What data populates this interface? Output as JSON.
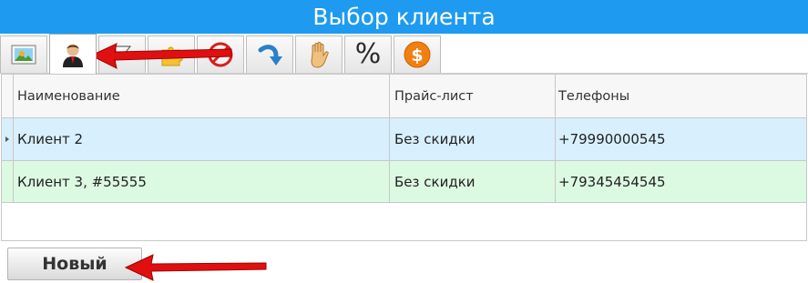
{
  "window": {
    "title": "Выбор клиента"
  },
  "toolbar": {
    "tabs": [
      {
        "icon": "image-icon"
      },
      {
        "icon": "user-icon",
        "active": true
      },
      {
        "icon": "flag-icon"
      },
      {
        "icon": "puzzle-icon"
      },
      {
        "icon": "no-entry-icon"
      },
      {
        "icon": "redo-arrow-icon"
      },
      {
        "icon": "hand-icon"
      },
      {
        "icon": "percent-icon",
        "glyph": "%"
      },
      {
        "icon": "dollar-coin-icon",
        "glyph": "$"
      }
    ]
  },
  "grid": {
    "columns": [
      "Наименование",
      "Прайс-лист",
      "Телефоны"
    ],
    "rows": [
      {
        "name": "Клиент 2",
        "price_list": "Без скидки",
        "phone": "+79990000545",
        "color": "#d8effd",
        "current": true
      },
      {
        "name": "Клиент 3, #55555",
        "price_list": "Без скидки",
        "phone": "+79345454545",
        "color": "#dcf9e2"
      }
    ]
  },
  "actions": {
    "new_label": "Новый"
  },
  "colors": {
    "titlebar": "#1e9bf0",
    "arrow": "#e01010"
  },
  "annotations": [
    {
      "icon": "red-arrow-icon",
      "points_to": "user-tab"
    },
    {
      "icon": "red-arrow-icon",
      "points_to": "new-button"
    }
  ]
}
